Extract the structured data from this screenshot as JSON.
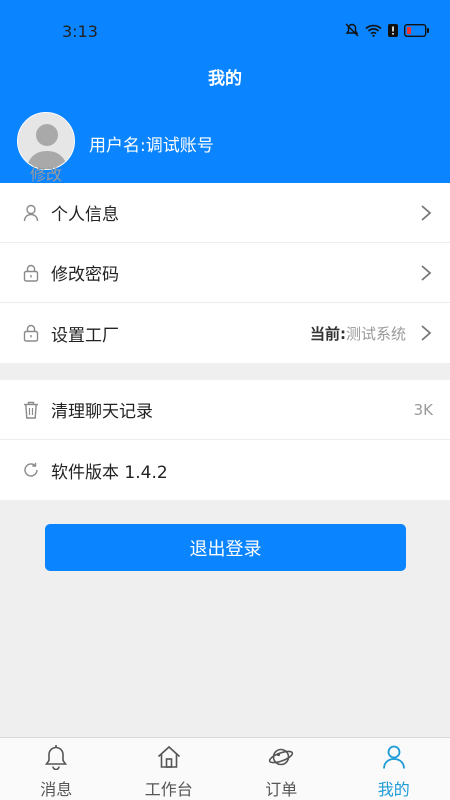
{
  "status": {
    "time": "3:13"
  },
  "header": {
    "title": "我的",
    "avatar_edit": "修改",
    "username": "用户名:调试账号"
  },
  "menu1": [
    {
      "label": "个人信息",
      "icon": "user-icon"
    },
    {
      "label": "修改密码",
      "icon": "lock-icon"
    },
    {
      "label": "设置工厂",
      "icon": "lock-icon",
      "right_prefix": "当前:",
      "right_value": "测试系统"
    }
  ],
  "menu2": [
    {
      "label": "清理聊天记录",
      "icon": "trash-icon",
      "right_value": "3K"
    },
    {
      "label": "软件版本 1.4.2",
      "icon": "refresh-icon"
    }
  ],
  "logout_label": "退出登录",
  "tabs": [
    {
      "label": "消息",
      "icon": "bell-icon"
    },
    {
      "label": "工作台",
      "icon": "home-icon"
    },
    {
      "label": "订单",
      "icon": "planet-icon"
    },
    {
      "label": "我的",
      "icon": "person-icon",
      "active": true
    }
  ],
  "colors": {
    "accent": "#0a84ff",
    "tab_active": "#1e9bd7"
  }
}
